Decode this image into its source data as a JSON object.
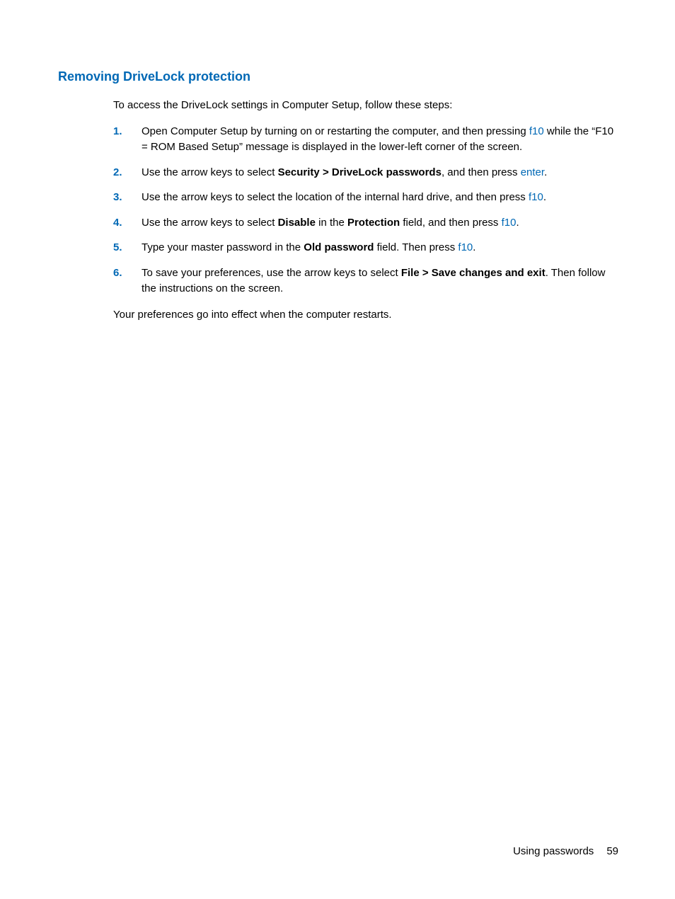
{
  "heading": "Removing DriveLock protection",
  "intro": "To access the DriveLock settings in Computer Setup, follow these steps:",
  "steps": [
    {
      "num": "1.",
      "parts": [
        {
          "text": "Open Computer Setup by turning on or restarting the computer, and then pressing "
        },
        {
          "text": "f10",
          "type": "key"
        },
        {
          "text": " while the “F10 = ROM Based Setup” message is displayed in the lower-left corner of the screen."
        }
      ]
    },
    {
      "num": "2.",
      "parts": [
        {
          "text": "Use the arrow keys to select "
        },
        {
          "text": "Security > DriveLock passwords",
          "type": "bold"
        },
        {
          "text": ", and then press "
        },
        {
          "text": "enter",
          "type": "key"
        },
        {
          "text": "."
        }
      ]
    },
    {
      "num": "3.",
      "parts": [
        {
          "text": "Use the arrow keys to select the location of the internal hard drive, and then press "
        },
        {
          "text": "f10",
          "type": "key"
        },
        {
          "text": "."
        }
      ]
    },
    {
      "num": "4.",
      "parts": [
        {
          "text": "Use the arrow keys to select "
        },
        {
          "text": "Disable",
          "type": "bold"
        },
        {
          "text": " in the "
        },
        {
          "text": "Protection",
          "type": "bold"
        },
        {
          "text": " field, and then press "
        },
        {
          "text": "f10",
          "type": "key"
        },
        {
          "text": "."
        }
      ]
    },
    {
      "num": "5.",
      "parts": [
        {
          "text": "Type your master password in the "
        },
        {
          "text": "Old password",
          "type": "bold"
        },
        {
          "text": " field. Then press "
        },
        {
          "text": "f10",
          "type": "key"
        },
        {
          "text": "."
        }
      ]
    },
    {
      "num": "6.",
      "parts": [
        {
          "text": "To save your preferences, use the arrow keys to select "
        },
        {
          "text": "File > Save changes and exit",
          "type": "bold"
        },
        {
          "text": ". Then follow the instructions on the screen."
        }
      ]
    }
  ],
  "closing": "Your preferences go into effect when the computer restarts.",
  "footer": {
    "section": "Using passwords",
    "page": "59"
  }
}
